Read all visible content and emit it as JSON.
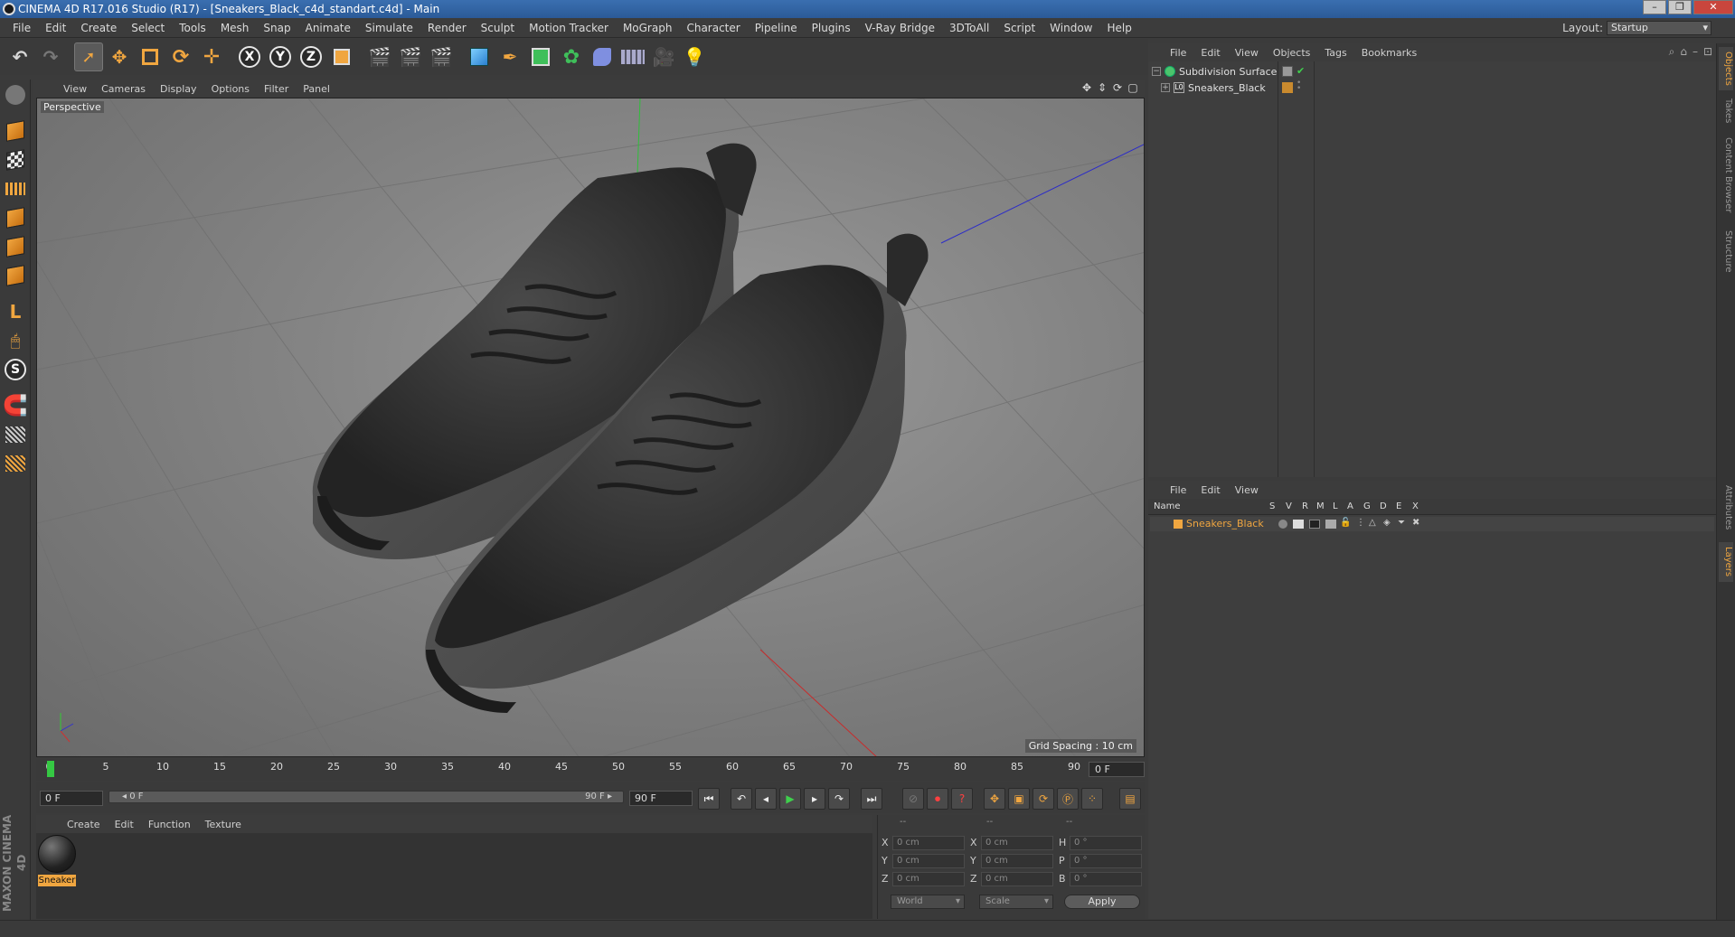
{
  "window": {
    "title": "CINEMA 4D R17.016 Studio (R17) - [Sneakers_Black_c4d_standart.c4d] - Main",
    "minimize": "–",
    "restore": "❐",
    "close": "✕"
  },
  "menubar": {
    "items": [
      "File",
      "Edit",
      "Create",
      "Select",
      "Tools",
      "Mesh",
      "Snap",
      "Animate",
      "Simulate",
      "Render",
      "Sculpt",
      "Motion Tracker",
      "MoGraph",
      "Character",
      "Pipeline",
      "Plugins",
      "V-Ray Bridge",
      "3DToAll",
      "Script",
      "Window",
      "Help"
    ],
    "layout_label": "Layout:",
    "layout_value": "Startup"
  },
  "toolbar": {
    "axis_x": "X",
    "axis_y": "Y",
    "axis_z": "Z"
  },
  "viewport": {
    "menu": [
      "View",
      "Cameras",
      "Display",
      "Options",
      "Filter",
      "Panel"
    ],
    "label": "Perspective",
    "grid_spacing": "Grid Spacing : 10 cm"
  },
  "timeline": {
    "ticks": [
      "0",
      "5",
      "10",
      "15",
      "20",
      "25",
      "30",
      "35",
      "40",
      "45",
      "50",
      "55",
      "60",
      "65",
      "70",
      "75",
      "80",
      "85",
      "90"
    ],
    "current_frame": "0 F"
  },
  "transport": {
    "start_field": "0 F",
    "range_start": "◂ 0 F",
    "range_end": "90 F ▸",
    "end_field": "90 F"
  },
  "material_manager": {
    "menu": [
      "Create",
      "Edit",
      "Function",
      "Texture"
    ],
    "materials": [
      {
        "name": "Sneaker"
      }
    ]
  },
  "coordinates": {
    "headers": [
      "--",
      "--",
      "--"
    ],
    "rows": [
      {
        "axis": "X",
        "pos": "0 cm",
        "axis2": "X",
        "size": "0 cm",
        "rot_axis": "H",
        "rot": "0 °"
      },
      {
        "axis": "Y",
        "pos": "0 cm",
        "axis2": "Y",
        "size": "0 cm",
        "rot_axis": "P",
        "rot": "0 °"
      },
      {
        "axis": "Z",
        "pos": "0 cm",
        "axis2": "Z",
        "size": "0 cm",
        "rot_axis": "B",
        "rot": "0 °"
      }
    ],
    "space": "World",
    "mode": "Scale",
    "apply": "Apply"
  },
  "object_manager": {
    "menu": [
      "File",
      "Edit",
      "View",
      "Objects",
      "Tags",
      "Bookmarks"
    ],
    "objects": [
      {
        "name": "Subdivision Surface"
      },
      {
        "name": "Sneakers_Black"
      }
    ]
  },
  "layer_manager": {
    "menu": [
      "File",
      "Edit",
      "View"
    ],
    "columns": [
      "Name",
      "S",
      "V",
      "R",
      "M",
      "L",
      "A",
      "G",
      "D",
      "E",
      "X"
    ],
    "layers": [
      {
        "name": "Sneakers_Black"
      }
    ]
  },
  "right_tabs": [
    "Objects",
    "Takes",
    "Content Browser",
    "Structure",
    "Attributes",
    "Layers"
  ],
  "branding": "MAXON CINEMA 4D",
  "colors": {
    "accent": "#f0a640",
    "play": "#3fd04d",
    "record": "#ff4040"
  }
}
